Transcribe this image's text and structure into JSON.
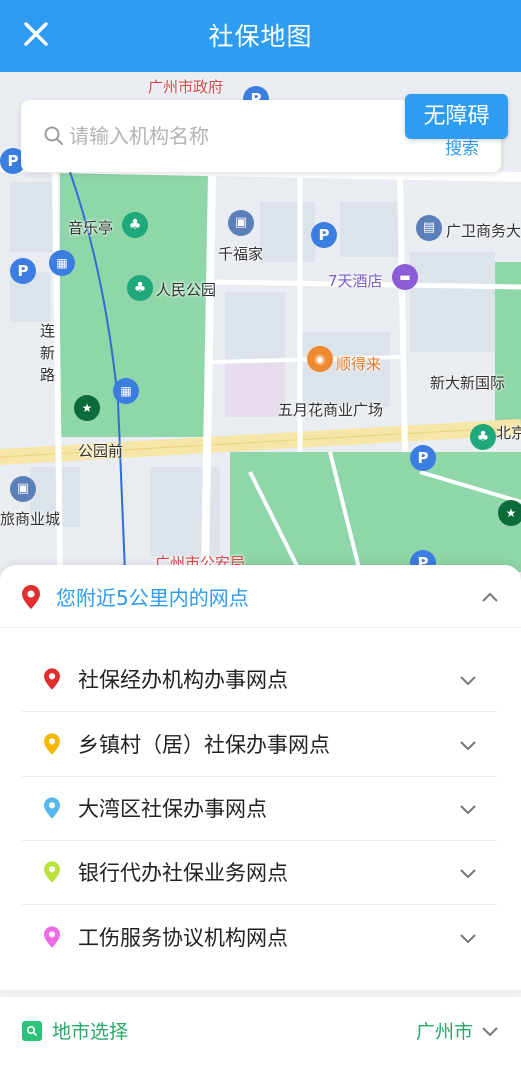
{
  "header": {
    "title": "社保地图",
    "close_icon": "close-icon"
  },
  "search": {
    "placeholder": "请输入机构名称",
    "value": "",
    "search_button": "搜索",
    "accessibility_button": "无障碍"
  },
  "map": {
    "labels": {
      "city_gov": "广州市政府",
      "music_pavilion": "音乐亭",
      "qianfujia": "千福家",
      "guangwei": "广卫商务大",
      "peoples_park": "人民公园",
      "seven_days": "7天酒店",
      "lianxin_road": "连新路",
      "shundelai": "顺得来",
      "xindaxin": "新大新国际",
      "wuyuehua": "五月花商业广场",
      "gongyuanqian": "公园前",
      "beijing_road": "北京路步行街旅游区",
      "lv_mall": "旅商业城",
      "city_pub": "广州市公安局"
    }
  },
  "sheet": {
    "header": "您附近5公里内的网点",
    "categories": [
      {
        "label": "社保经办机构办事网点",
        "color": "#e02f2f"
      },
      {
        "label": "乡镇村（居）社保办事网点",
        "color": "#f5b800"
      },
      {
        "label": "大湾区社保办事网点",
        "color": "#55b8ee"
      },
      {
        "label": "银行代办社保业务网点",
        "color": "#b9e23a"
      },
      {
        "label": "工伤服务协议机构网点",
        "color": "#f06ae8"
      }
    ]
  },
  "footer": {
    "label": "地市选择",
    "city": "广州市"
  },
  "colors": {
    "primary": "#2e9cf0",
    "green": "#2aa86a"
  }
}
